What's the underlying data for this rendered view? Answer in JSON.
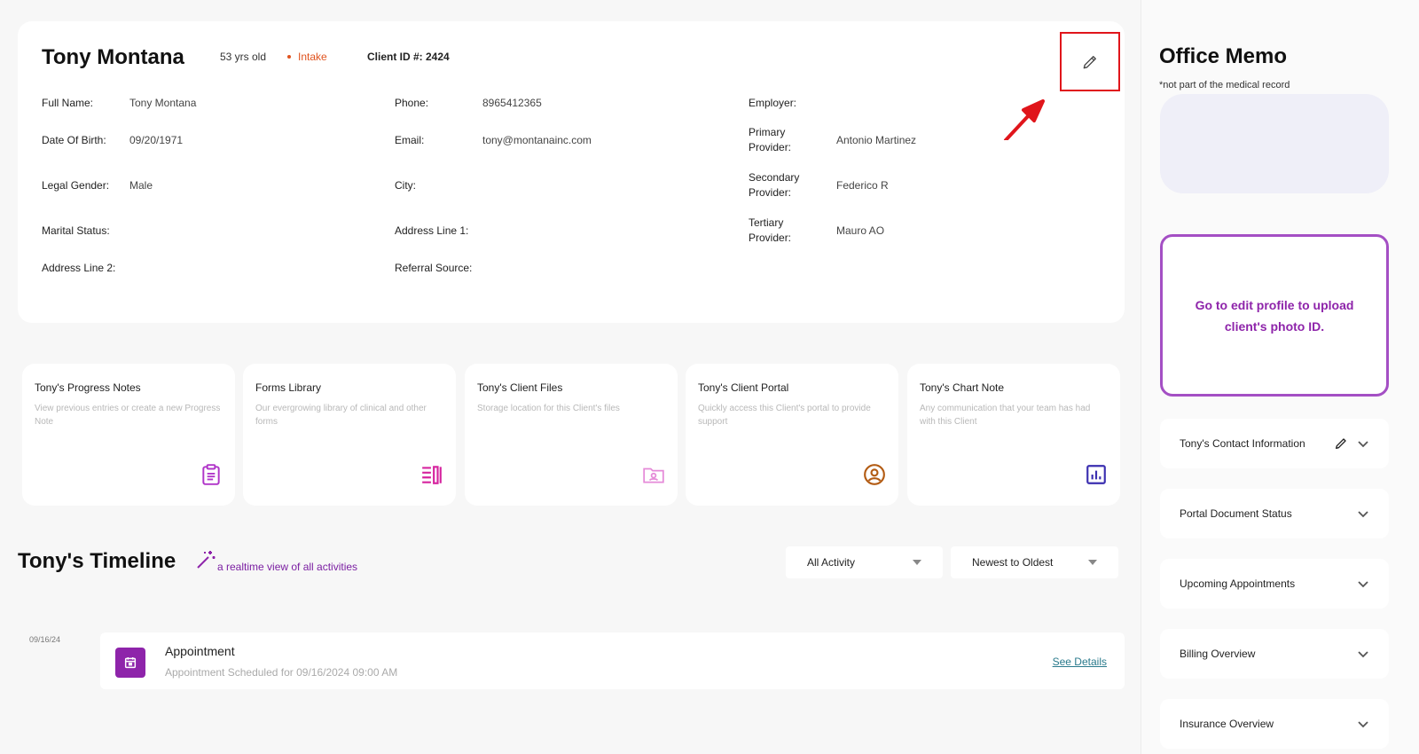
{
  "client": {
    "name": "Tony Montana",
    "age": "53 yrs old",
    "status": "Intake",
    "status_color": "#e0531f",
    "client_id": "Client ID #: 2424"
  },
  "fields": {
    "full_name": {
      "label": "Full Name:",
      "value": "Tony Montana"
    },
    "dob": {
      "label": "Date Of Birth:",
      "value": "09/20/1971"
    },
    "gender": {
      "label": "Legal Gender:",
      "value": "Male"
    },
    "marital": {
      "label": "Marital Status:",
      "value": ""
    },
    "address2": {
      "label": "Address Line 2:",
      "value": ""
    },
    "phone": {
      "label": "Phone:",
      "value": "8965412365"
    },
    "email": {
      "label": "Email:",
      "value": "tony@montanainc.com"
    },
    "city": {
      "label": "City:",
      "value": ""
    },
    "address1": {
      "label": "Address Line 1:",
      "value": ""
    },
    "referral": {
      "label": "Referral Source:",
      "value": ""
    },
    "employer": {
      "label": "Employer:",
      "value": ""
    },
    "primary": {
      "label": "Primary Provider:",
      "value": "Antonio Martinez"
    },
    "secondary": {
      "label": "Secondary Provider:",
      "value": "Federico R"
    },
    "tertiary": {
      "label": "Tertiary Provider:",
      "value": "Mauro AO"
    }
  },
  "tiles": [
    {
      "title": "Tony's Progress Notes",
      "desc": "View previous entries or create a new Progress Note",
      "icon": "clipboard-icon",
      "color": "#b035c9"
    },
    {
      "title": "Forms Library",
      "desc": "Our evergrowing library of clinical and other forms",
      "icon": "library-icon",
      "color": "#d6249f"
    },
    {
      "title": "Tony's Client Files",
      "desc": "Storage location for this Client's files",
      "icon": "folder-user-icon",
      "color": "#e58ad8"
    },
    {
      "title": "Tony's Client Portal",
      "desc": "Quickly access this Client's portal to provide support",
      "icon": "user-circle-icon",
      "color": "#b35c14"
    },
    {
      "title": "Tony's Chart Note",
      "desc": "Any communication that your team has had with this Client",
      "icon": "chart-icon",
      "color": "#3b2fb0"
    }
  ],
  "timeline": {
    "title": "Tony's Timeline",
    "subtitle": "a realtime view of all activities",
    "filter_activity": "All Activity",
    "filter_sort": "Newest to Oldest",
    "items": [
      {
        "date": "09/16/24",
        "title": "Appointment",
        "desc": "Appointment Scheduled for 09/16/2024 09:00 AM",
        "link": "See Details"
      }
    ]
  },
  "sidebar": {
    "memo_title": "Office Memo",
    "memo_note": "*not part of the medical record",
    "photo_prompt": "Go to edit profile to upload client's photo ID.",
    "accordions": [
      "Tony's Contact Information",
      "Portal Document Status",
      "Upcoming Appointments",
      "Billing Overview",
      "Insurance Overview"
    ]
  }
}
